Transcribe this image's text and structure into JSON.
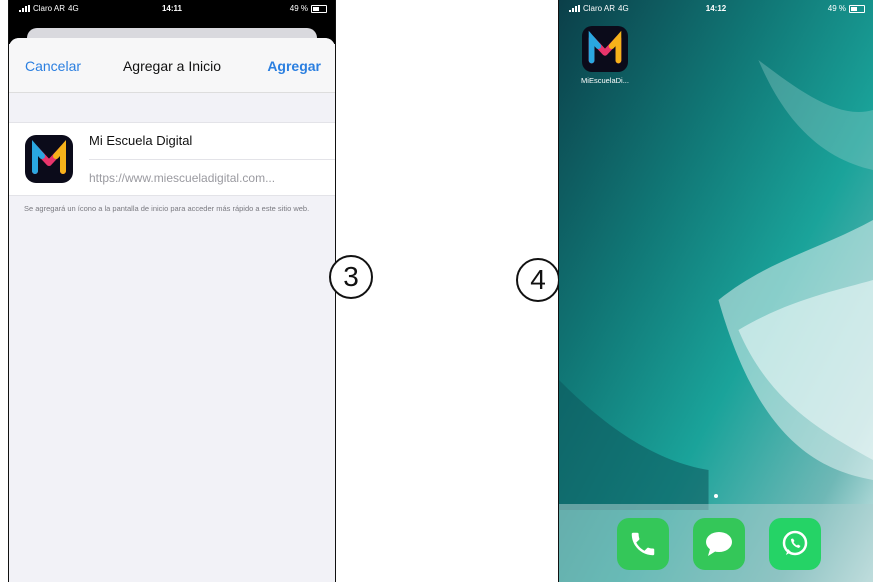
{
  "left_phone": {
    "status": {
      "carrier": "Claro AR",
      "network": "4G",
      "time": "14:11",
      "battery": "49 %"
    },
    "nav": {
      "cancel": "Cancelar",
      "title": "Agregar a Inicio",
      "add": "Agregar"
    },
    "app_name": "Mi Escuela Digital",
    "url": "https://www.miescueladigital.com...",
    "hint": "Se agregará un ícono a la pantalla de inicio para acceder más rápido a este sitio web."
  },
  "step_numbers": {
    "left": "3",
    "right": "4"
  },
  "right_phone": {
    "status": {
      "carrier": "Claro AR",
      "network": "4G",
      "time": "14:12",
      "battery": "49 %"
    },
    "home_app_label": "MiEscuelaDi...",
    "dock": [
      {
        "icon": "phone-icon"
      },
      {
        "icon": "messages-icon"
      },
      {
        "icon": "whatsapp-icon"
      }
    ]
  },
  "colors": {
    "ios_blue": "#2b7fe0",
    "green": "#34c759",
    "whatsapp": "#25d366",
    "icon_bg": "#0b0b1a"
  }
}
